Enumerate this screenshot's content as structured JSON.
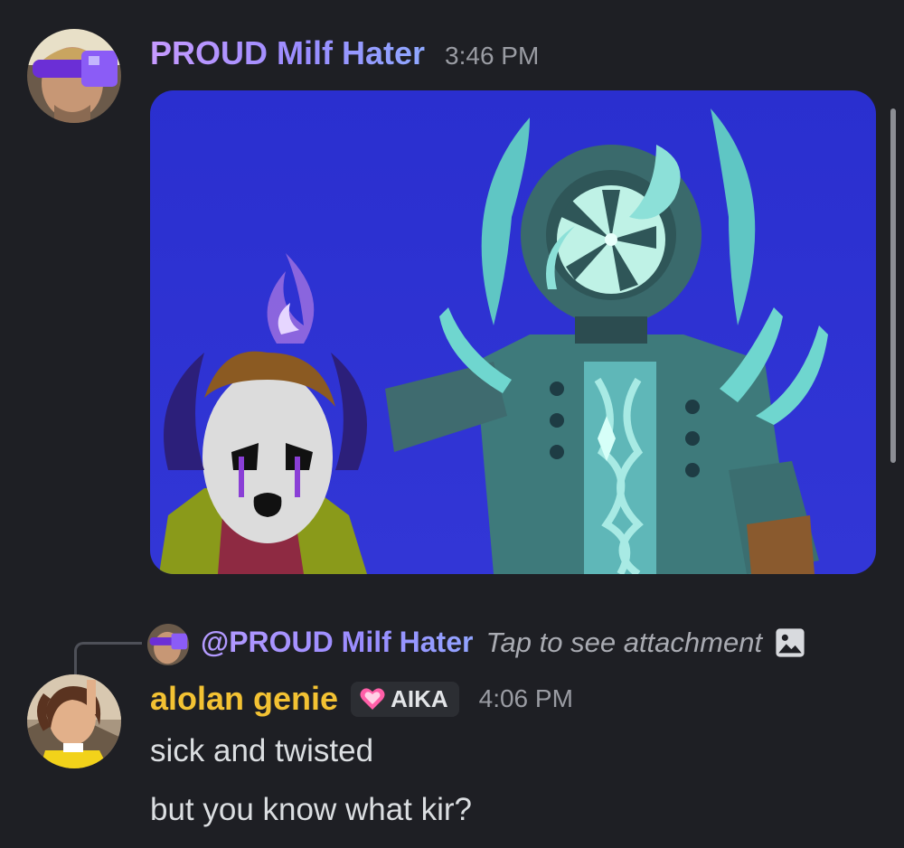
{
  "messages": [
    {
      "author": "PROUD Milf Hater",
      "timestamp": "3:46 PM",
      "attachment": {
        "kind": "image",
        "description_colors": {
          "background": "#2d2ed0",
          "teal": "#6fd6cf",
          "purple": "#8a3fd6"
        }
      }
    },
    {
      "author": "alolan genie",
      "author_color": "#f3c233",
      "tag": {
        "icon": "pink-heart-icon",
        "label": "AIKA"
      },
      "timestamp": "4:06 PM",
      "reply": {
        "mention": "@PROUD Milf Hater",
        "preview": "Tap to see attachment",
        "icon": "image-icon"
      },
      "lines": [
        "sick and twisted",
        "but you know what kir?"
      ]
    }
  ]
}
